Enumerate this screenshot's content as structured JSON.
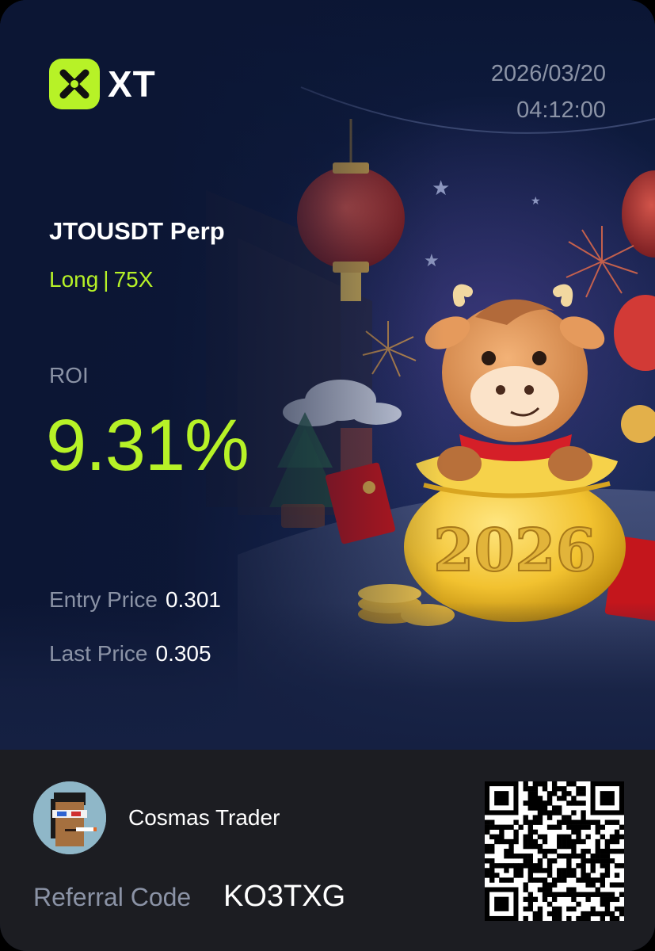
{
  "brand": {
    "name": "XT",
    "accent": "#b7f227",
    "logo_icon": "xt-logo-icon"
  },
  "timestamp": {
    "date": "2026/03/20",
    "time": "04:12:00"
  },
  "position": {
    "pair": "JTOUSDT Perp",
    "direction": "Long",
    "separator": "|",
    "leverage": "75X"
  },
  "roi": {
    "label": "ROI",
    "value": "9.31%"
  },
  "prices": {
    "entry_label": "Entry Price",
    "entry_value": "0.301",
    "last_label": "Last Price",
    "last_value": "0.305"
  },
  "hero_image": {
    "badge_text": "2026",
    "icon": "festive-ox-illustration"
  },
  "user": {
    "name": "Cosmas Trader",
    "avatar_icon": "pixel-avatar-icon"
  },
  "referral": {
    "label": "Referral Code",
    "code": "KO3TXG",
    "qr_icon": "referral-qr-code"
  },
  "colors": {
    "background": "#0f1b3a",
    "footer": "#1c1d22",
    "muted_text": "#8b93a6"
  }
}
